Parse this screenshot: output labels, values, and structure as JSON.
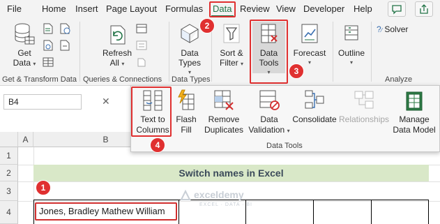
{
  "menu": {
    "tabs": [
      "File",
      "Home",
      "Insert",
      "Page Layout",
      "Formulas",
      "Data",
      "Review",
      "View",
      "Developer",
      "Help"
    ],
    "active_tab": "Data",
    "accent_color": "#217346",
    "highlight_color": "#e03030"
  },
  "ribbon": {
    "get_data": {
      "label1": "Get",
      "label2": "Data"
    },
    "refresh_all": {
      "label1": "Refresh",
      "label2": "All"
    },
    "data_types": {
      "label1": "Data",
      "label2": "Types"
    },
    "sort_filter": {
      "label1": "Sort &",
      "label2": "Filter"
    },
    "data_tools": {
      "label1": "Data",
      "label2": "Tools"
    },
    "forecast": {
      "label": "Forecast"
    },
    "outline": {
      "label": "Outline"
    },
    "solver": {
      "label": "Solver"
    },
    "groups": {
      "get_transform": "Get & Transform Data",
      "queries": "Queries & Connections",
      "data_types": "Data Types",
      "analyze": "Analyze"
    }
  },
  "formula_bar": {
    "name_box": "B4",
    "cancel_icon": "✕"
  },
  "data_tools_panel": {
    "group_label": "Data Tools",
    "buttons": [
      {
        "line1": "Text to",
        "line2": "Columns"
      },
      {
        "line1": "Flash",
        "line2": "Fill"
      },
      {
        "line1": "Remove",
        "line2": "Duplicates"
      },
      {
        "line1": "Data",
        "line2": "Validation"
      },
      {
        "line1": "Consolidate",
        "line2": ""
      },
      {
        "line1": "Relationships",
        "line2": ""
      },
      {
        "line1": "Manage",
        "line2": "Data Model"
      }
    ]
  },
  "badges": [
    "1",
    "2",
    "3",
    "4"
  ],
  "sheet": {
    "columns": [
      "A",
      "B"
    ],
    "rows": [
      "1",
      "2",
      "3",
      "4"
    ],
    "title": "Switch names in Excel",
    "cell_b4": "Jones, Bradley Mathew William"
  },
  "watermark": {
    "name": "exceldemy",
    "sub": "EXCEL · DATA · BI"
  }
}
